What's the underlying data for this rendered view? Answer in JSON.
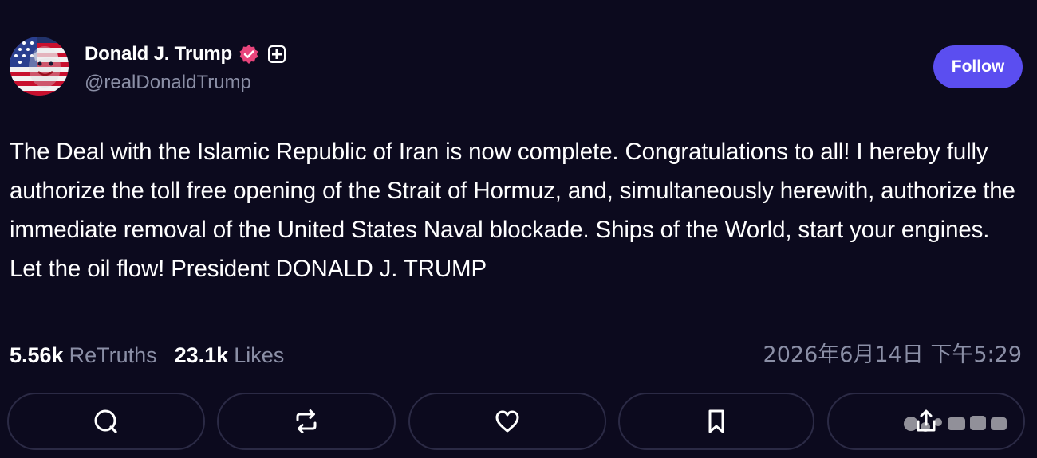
{
  "author": {
    "display_name": "Donald J. Trump",
    "handle": "@realDonaldTrump",
    "avatar_icon": "american-flag-portrait",
    "verified_icon": "verified-badge-icon",
    "verified_color": "#e8457c",
    "plus_icon": "plus-badge-icon"
  },
  "follow_button": {
    "label": "Follow",
    "color": "#5b4ef0"
  },
  "post": {
    "text": "The Deal with the Islamic Republic of Iran is now complete. Congratulations to all! I hereby fully authorize the toll free opening of the Strait of Hormuz, and, simultaneously herewith, authorize the immediate removal of the United States Naval blockade. Ships of the World, start your engines. Let the oil flow! President DONALD J. TRUMP"
  },
  "stats": {
    "retruths_count": "5.56k",
    "retruths_label": "ReTruths",
    "likes_count": "23.1k",
    "likes_label": "Likes"
  },
  "timestamp": "2026年6月14日 下午5:29",
  "actions": [
    {
      "name": "reply",
      "icon": "comment-icon"
    },
    {
      "name": "retruth",
      "icon": "repost-icon"
    },
    {
      "name": "like",
      "icon": "heart-icon"
    },
    {
      "name": "bookmark",
      "icon": "bookmark-icon"
    },
    {
      "name": "share",
      "icon": "share-icon"
    }
  ],
  "theme": {
    "background": "#0c0a1e",
    "muted_text": "#8b8fa6",
    "button_border": "#2b2a45"
  }
}
